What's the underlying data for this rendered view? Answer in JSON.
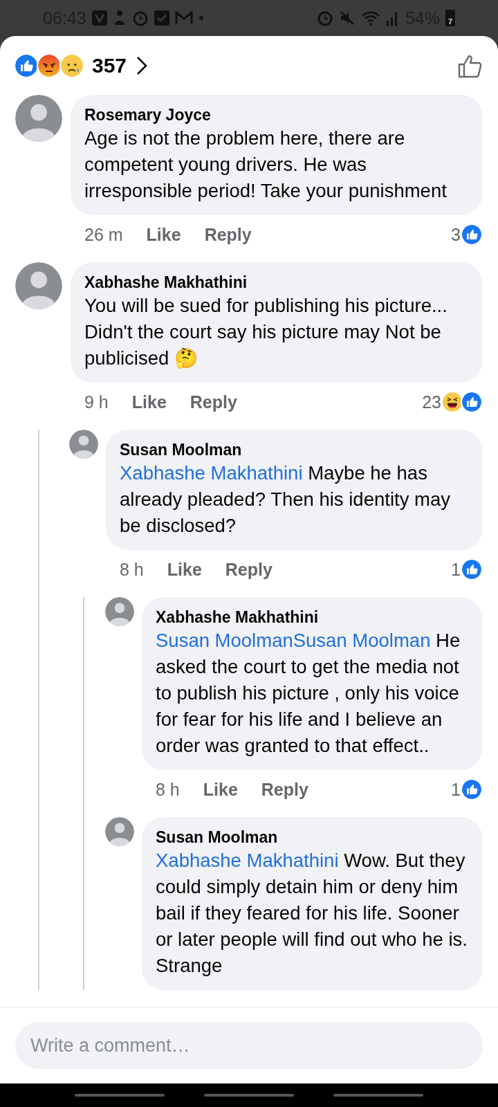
{
  "status_bar": {
    "time": "06:43",
    "battery": "54%",
    "battery_level_label": "7"
  },
  "header": {
    "reactions": [
      {
        "kind": "like"
      },
      {
        "kind": "angry"
      },
      {
        "kind": "sad"
      }
    ],
    "count": "357"
  },
  "comments": [
    {
      "author": "Rosemary Joyce",
      "text": "Age is not the problem here, there are competent young drivers. He was irresponsible period! Take your punishment",
      "time": "26 m",
      "actions": [
        "Like",
        "Reply"
      ],
      "count": "3",
      "reactions": [
        {
          "kind": "like"
        }
      ]
    },
    {
      "author": "Xabhashe Makhathini",
      "text": "You will be sued for publishing his picture...\nDidn't the court say his picture may Not be publicised 🤔",
      "time": "9 h",
      "actions": [
        "Like",
        "Reply"
      ],
      "count": "23",
      "reactions": [
        {
          "kind": "haha"
        },
        {
          "kind": "like"
        }
      ],
      "children": [
        {
          "author": "Susan Moolman",
          "mention": "Xabhashe Makhathini",
          "text": "Maybe he has already pleaded? Then his identity may be disclosed?",
          "time": "8 h",
          "actions": [
            "Like",
            "Reply"
          ],
          "count": "1",
          "reactions": [
            {
              "kind": "like"
            }
          ],
          "children": [
            {
              "author": "Xabhashe Makhathini",
              "mention": "Susan MoolmanSusan Moolman",
              "text": "He asked the court to get the media not to publish his picture , only his voice for fear for his life and I believe an order was granted to that effect..",
              "time": "8 h",
              "actions": [
                "Like",
                "Reply"
              ],
              "count": "1",
              "reactions": [
                {
                  "kind": "like"
                }
              ]
            },
            {
              "author": "Susan Moolman",
              "mention": "Xabhashe Makhathini",
              "text": "Wow. But they could simply detain him or deny him bail if they feared for his life. Sooner or later people will find out who he is. Strange"
            }
          ]
        }
      ]
    }
  ],
  "composer": {
    "placeholder": "Write a comment…"
  }
}
